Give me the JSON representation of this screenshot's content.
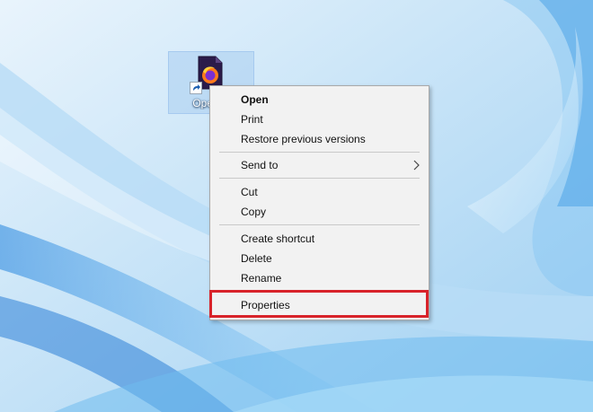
{
  "desktop": {
    "icon_label": "Open C",
    "icon_name": "firefox-file-icon"
  },
  "context_menu": {
    "items": [
      {
        "label": "Open",
        "bold": true
      },
      {
        "label": "Print"
      },
      {
        "label": "Restore previous versions"
      },
      {
        "label": "Send to",
        "submenu": true
      },
      {
        "label": "Cut"
      },
      {
        "label": "Copy"
      },
      {
        "label": "Create shortcut"
      },
      {
        "label": "Delete"
      },
      {
        "label": "Rename"
      },
      {
        "label": "Properties",
        "highlighted": true
      }
    ]
  },
  "colors": {
    "highlight_border": "#d8232a",
    "menu_background": "#f2f2f2"
  }
}
